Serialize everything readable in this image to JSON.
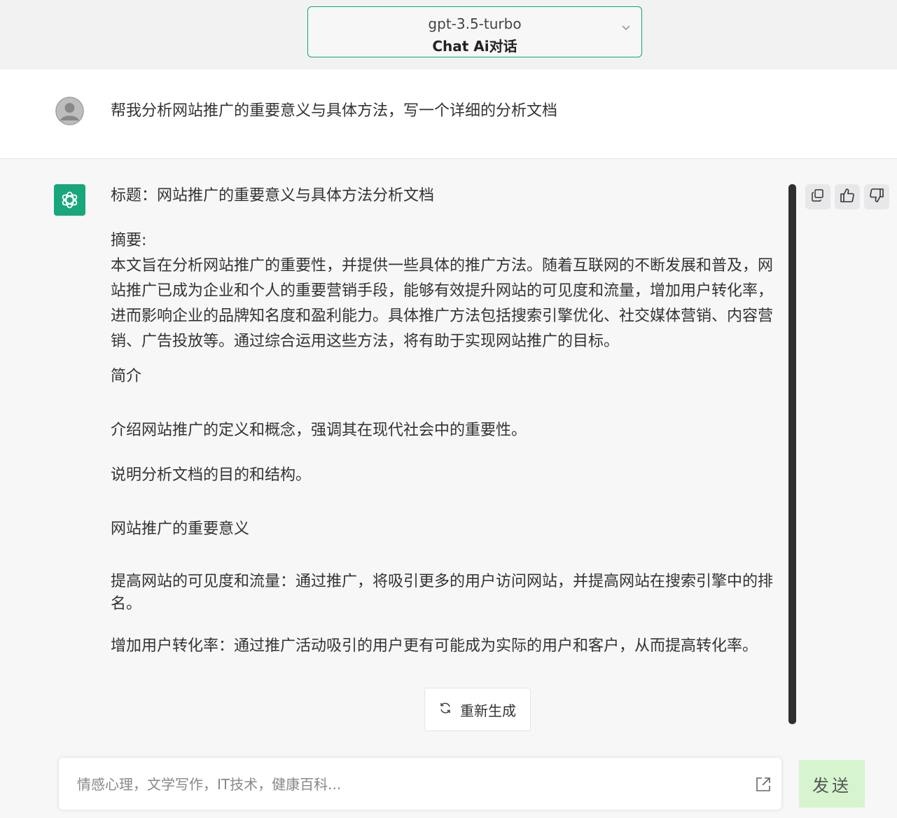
{
  "header": {
    "model": "gpt-3.5-turbo",
    "subtitle": "Chat Ai对话"
  },
  "user_message": "帮我分析网站推广的重要意义与具体方法，写一个详细的分析文档",
  "answer": {
    "title": "标题：网站推广的重要意义与具体方法分析文档",
    "abstract_label": "摘要:",
    "abstract_text": "本文旨在分析网站推广的重要性，并提供一些具体的推广方法。随着互联网的不断发展和普及，网站推广已成为企业和个人的重要营销手段，能够有效提升网站的可见度和流量，增加用户转化率，进而影响企业的品牌知名度和盈利能力。具体推广方法包括搜索引擎优化、社交媒体营销、内容营销、广告投放等。通过综合运用这些方法，将有助于实现网站推广的目标。",
    "intro_heading": "简介",
    "intro_p1": "介绍网站推广的定义和概念，强调其在现代社会中的重要性。",
    "intro_p2": "说明分析文档的目的和结构。",
    "significance_heading": "网站推广的重要意义",
    "point1": "提高网站的可见度和流量：通过推广，将吸引更多的用户访问网站，并提高网站在搜索引擎中的排名。",
    "point2": "增加用户转化率：通过推广活动吸引的用户更有可能成为实际的用户和客户，从而提高转化率。"
  },
  "actions": {
    "copy_icon": "copy-icon",
    "like_icon": "thumbs-up-icon",
    "dislike_icon": "thumbs-down-icon"
  },
  "regenerate_label": "重新生成",
  "input": {
    "placeholder": "情感心理，文学写作，IT技术，健康百科...",
    "value": ""
  },
  "send_label": "发送",
  "colors": {
    "accent": "#10a37f",
    "bot_logo": "#19a67c",
    "send_bg": "#d6f5cf"
  }
}
